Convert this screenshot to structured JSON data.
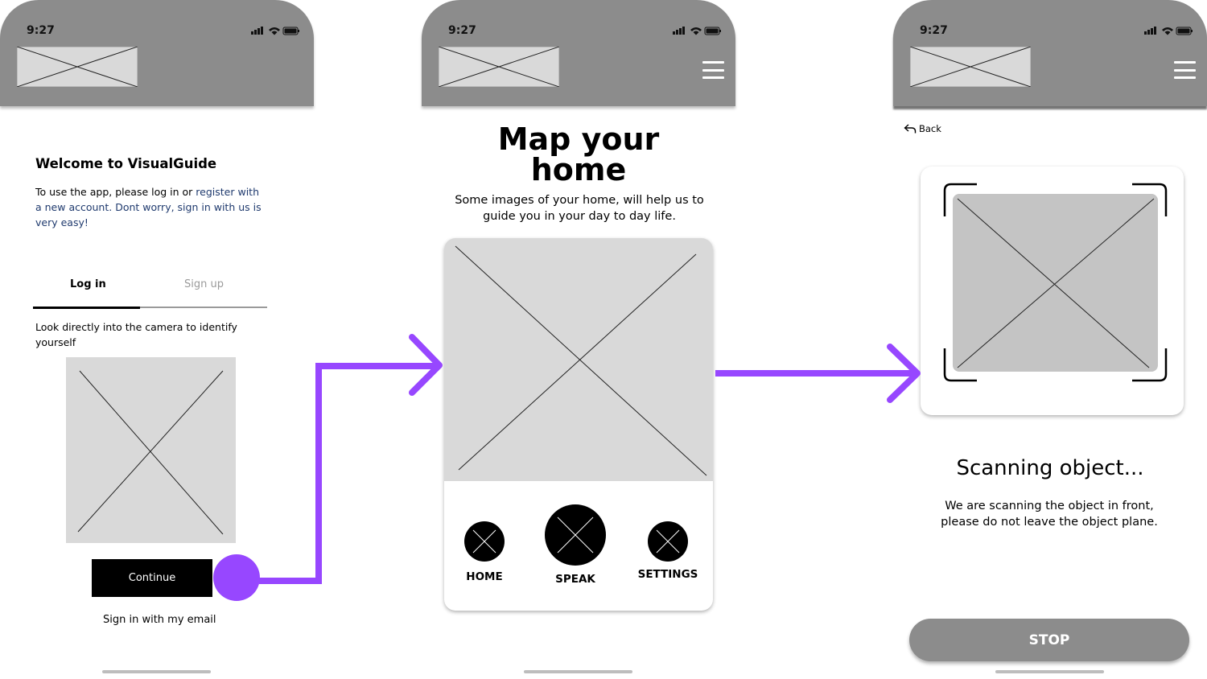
{
  "status_bar": {
    "time": "9:27"
  },
  "screen1": {
    "welcome_title": "Welcome to VisualGuide",
    "intro_prefix": "To use the app, please log in or ",
    "intro_link": "register with",
    "intro_line2": "a new account. Dont worry, sign in with us is",
    "intro_line3": "very easy!",
    "tabs": [
      {
        "label": "Log in",
        "active": true
      },
      {
        "label": "Sign up",
        "active": false
      }
    ],
    "camera_instruction_line1": "Look directly into the camera to identify",
    "camera_instruction_line2": "yourself",
    "continue_label": "Continue",
    "email_signin_label": "Sign in with my email"
  },
  "screen2": {
    "title_line1": "Map your",
    "title_line2": "home",
    "subtitle_line1": "Some images of your home, will help us to",
    "subtitle_line2": "guide you in your day to day life.",
    "nav": [
      {
        "label": "HOME"
      },
      {
        "label": "SPEAK"
      },
      {
        "label": "SETTINGS"
      }
    ]
  },
  "screen3": {
    "back_label": "Back",
    "scanning_title": "Scanning object...",
    "scanning_line1": "We are scanning the object in front,",
    "scanning_line2": "please do not leave the object plane.",
    "stop_label": "STOP"
  },
  "colors": {
    "header_gray": "#8c8c8c",
    "placeholder_gray": "#d9d9d9",
    "scanner_gray": "#c4c4c4",
    "flow_arrow_purple": "#9747ff",
    "link_blue": "#1f3a6e",
    "stop_button_gray": "#8c8c8c"
  }
}
